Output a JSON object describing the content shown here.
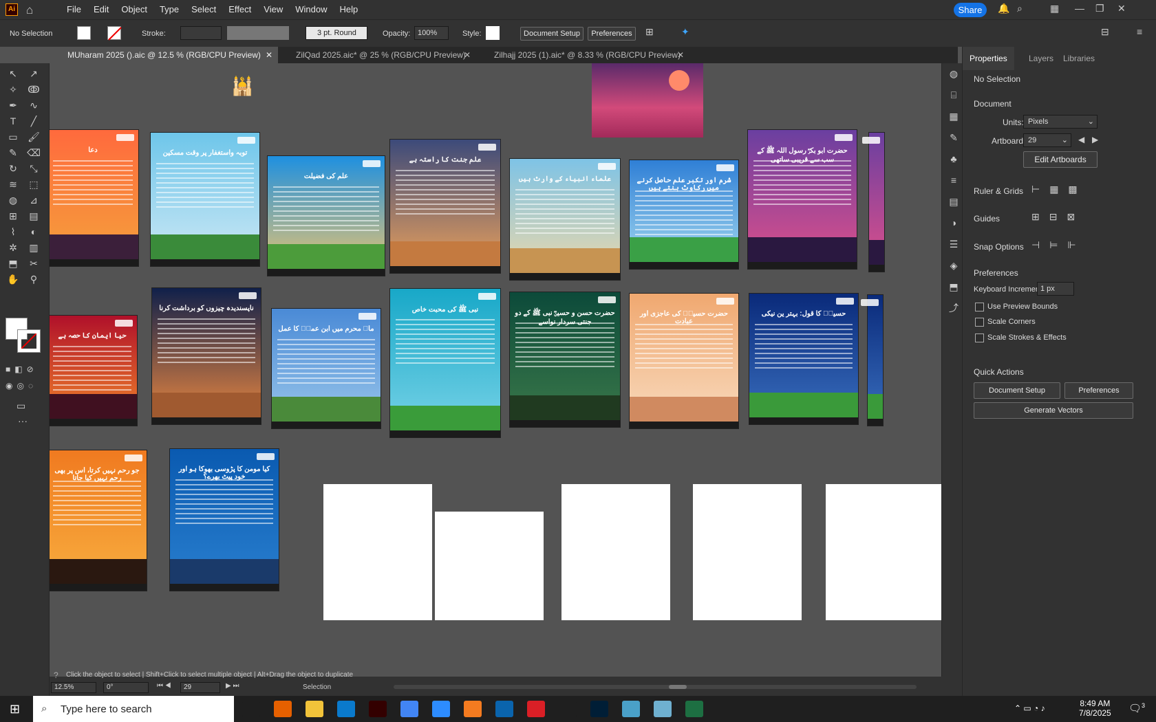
{
  "app": {
    "logo": "Ai"
  },
  "menu": [
    "File",
    "Edit",
    "Object",
    "Type",
    "Select",
    "Effect",
    "View",
    "Window",
    "Help"
  ],
  "share_label": "Share",
  "control": {
    "selection": "No Selection",
    "stroke_label": "Stroke:",
    "brush": "3 pt. Round",
    "opacity_label": "Opacity:",
    "opacity": "100%",
    "style_label": "Style:",
    "doc_setup": "Document Setup",
    "preferences": "Preferences"
  },
  "tabs": [
    {
      "label": "MUharam 2025 ().aic @ 12.5 % (RGB/CPU Preview)"
    },
    {
      "label": "ZilQad 2025.aic* @ 25 % (RGB/CPU Preview)"
    },
    {
      "label": "Zilhajj 2025 (1).aic* @ 8.33 % (RGB/CPU Preview)"
    }
  ],
  "artboards": [
    {
      "title": "دعا",
      "c1": "#ff6a3d",
      "c2": "#f4a23c",
      "hill": "#3b1f3a"
    },
    {
      "title": "توبہ واستغفار پر وقت مسکین",
      "c1": "#6ec6ea",
      "c2": "#cfe9f5",
      "hill": "#3a8b3a"
    },
    {
      "title": "علم کی فضیلت",
      "c1": "#1e90e0",
      "c2": "#f2c66b",
      "hill": "#4c9c3b"
    },
    {
      "title": "علم جنت کا راستہ ہے",
      "c1": "#3c4a7a",
      "c2": "#f0a35a",
      "hill": "#c47a40"
    },
    {
      "title": "علماء انبیاء کے وارث ہیں",
      "c1": "#7ec3e6",
      "c2": "#f0d9a8",
      "hill": "#c79452"
    },
    {
      "title": "شرم اور تکبر علم حاصل کرنے میں رکاوٹ بنتے ہیں",
      "c1": "#2f7fd6",
      "c2": "#a8dcf0",
      "hill": "#3aa046"
    },
    {
      "title": "حضرت ابو بکرؓ رسول اللہ ﷺ کے سب سے قریبی ساتھی",
      "c1": "#6a3fa0",
      "c2": "#e0508a",
      "hill": "#2a1840"
    },
    {
      "title": "حیا ایمان کا حصہ ہے",
      "c1": "#b0102a",
      "c2": "#f48a2a",
      "hill": "#401020"
    },
    {
      "title": "ناپسندیدہ چیزوں کو برداشت کرنا",
      "c1": "#10204a",
      "c2": "#f08a40",
      "hill": "#a05a30"
    },
    {
      "title": "ماہ محرم میں ابن عمرؓ کا عمل",
      "c1": "#4a8ad6",
      "c2": "#9cc8ec",
      "hill": "#4a8a3a"
    },
    {
      "title": "نبی ﷺ کی محبت خاص",
      "c1": "#18a8c8",
      "c2": "#7ad4e8",
      "hill": "#3a9c3a"
    },
    {
      "title": "حضرت حسن و حسینؓ نبی ﷺ کے دو جنتی سردار نواسے",
      "c1": "#0c4a3a",
      "c2": "#3c7a4a",
      "hill": "#203a20"
    },
    {
      "title": "حضرت حسینؓ کی عاجزی اور عبادت",
      "c1": "#f0a870",
      "c2": "#f8dcc0",
      "hill": "#d08a60"
    },
    {
      "title": "حسینؓ کا قول: بہتر ین نیکی",
      "c1": "#0a2a7a",
      "c2": "#3a70c0",
      "hill": "#3a9a3a"
    },
    {
      "title": "جو رحم نہیں کرتا، اس پر بھی رحم نہیں کیا جاتا",
      "c1": "#f07a20",
      "c2": "#f8b040",
      "hill": "#2a1810"
    },
    {
      "title": "کیا مومن کا پڑوسی بھوکا ہو اور خود پیٹ بھرے؟",
      "c1": "#0a5ab0",
      "c2": "#2a80d0",
      "hill": "#1a3a6a"
    }
  ],
  "panel": {
    "tabs": [
      "Properties",
      "Layers",
      "Libraries"
    ],
    "no_selection": "No Selection",
    "document": "Document",
    "units_label": "Units:",
    "units": "Pixels",
    "artboard_label": "Artboard:",
    "artboard": "29",
    "edit_artboards": "Edit Artboards",
    "ruler_grids": "Ruler & Grids",
    "guides": "Guides",
    "snap": "Snap Options",
    "preferences": "Preferences",
    "kb_label": "Keyboard Increment:",
    "kb_value": "1 px",
    "preview_bounds": "Use Preview Bounds",
    "scale_corners": "Scale Corners",
    "scale_strokes": "Scale Strokes & Effects",
    "quick_actions": "Quick Actions",
    "doc_setup": "Document Setup",
    "prefs_btn": "Preferences",
    "gen_vectors": "Generate Vectors"
  },
  "status": {
    "hint": "Click the object to select  |  Shift+Click to select multiple object  |  Alt+Drag the object to duplicate",
    "zoom": "12.5%",
    "angle": "0°",
    "artboard": "29",
    "mode": "Selection"
  },
  "taskbar": {
    "search": "Type here to search",
    "time": "8:49 AM",
    "date": "7/8/2025",
    "notif": "3"
  }
}
